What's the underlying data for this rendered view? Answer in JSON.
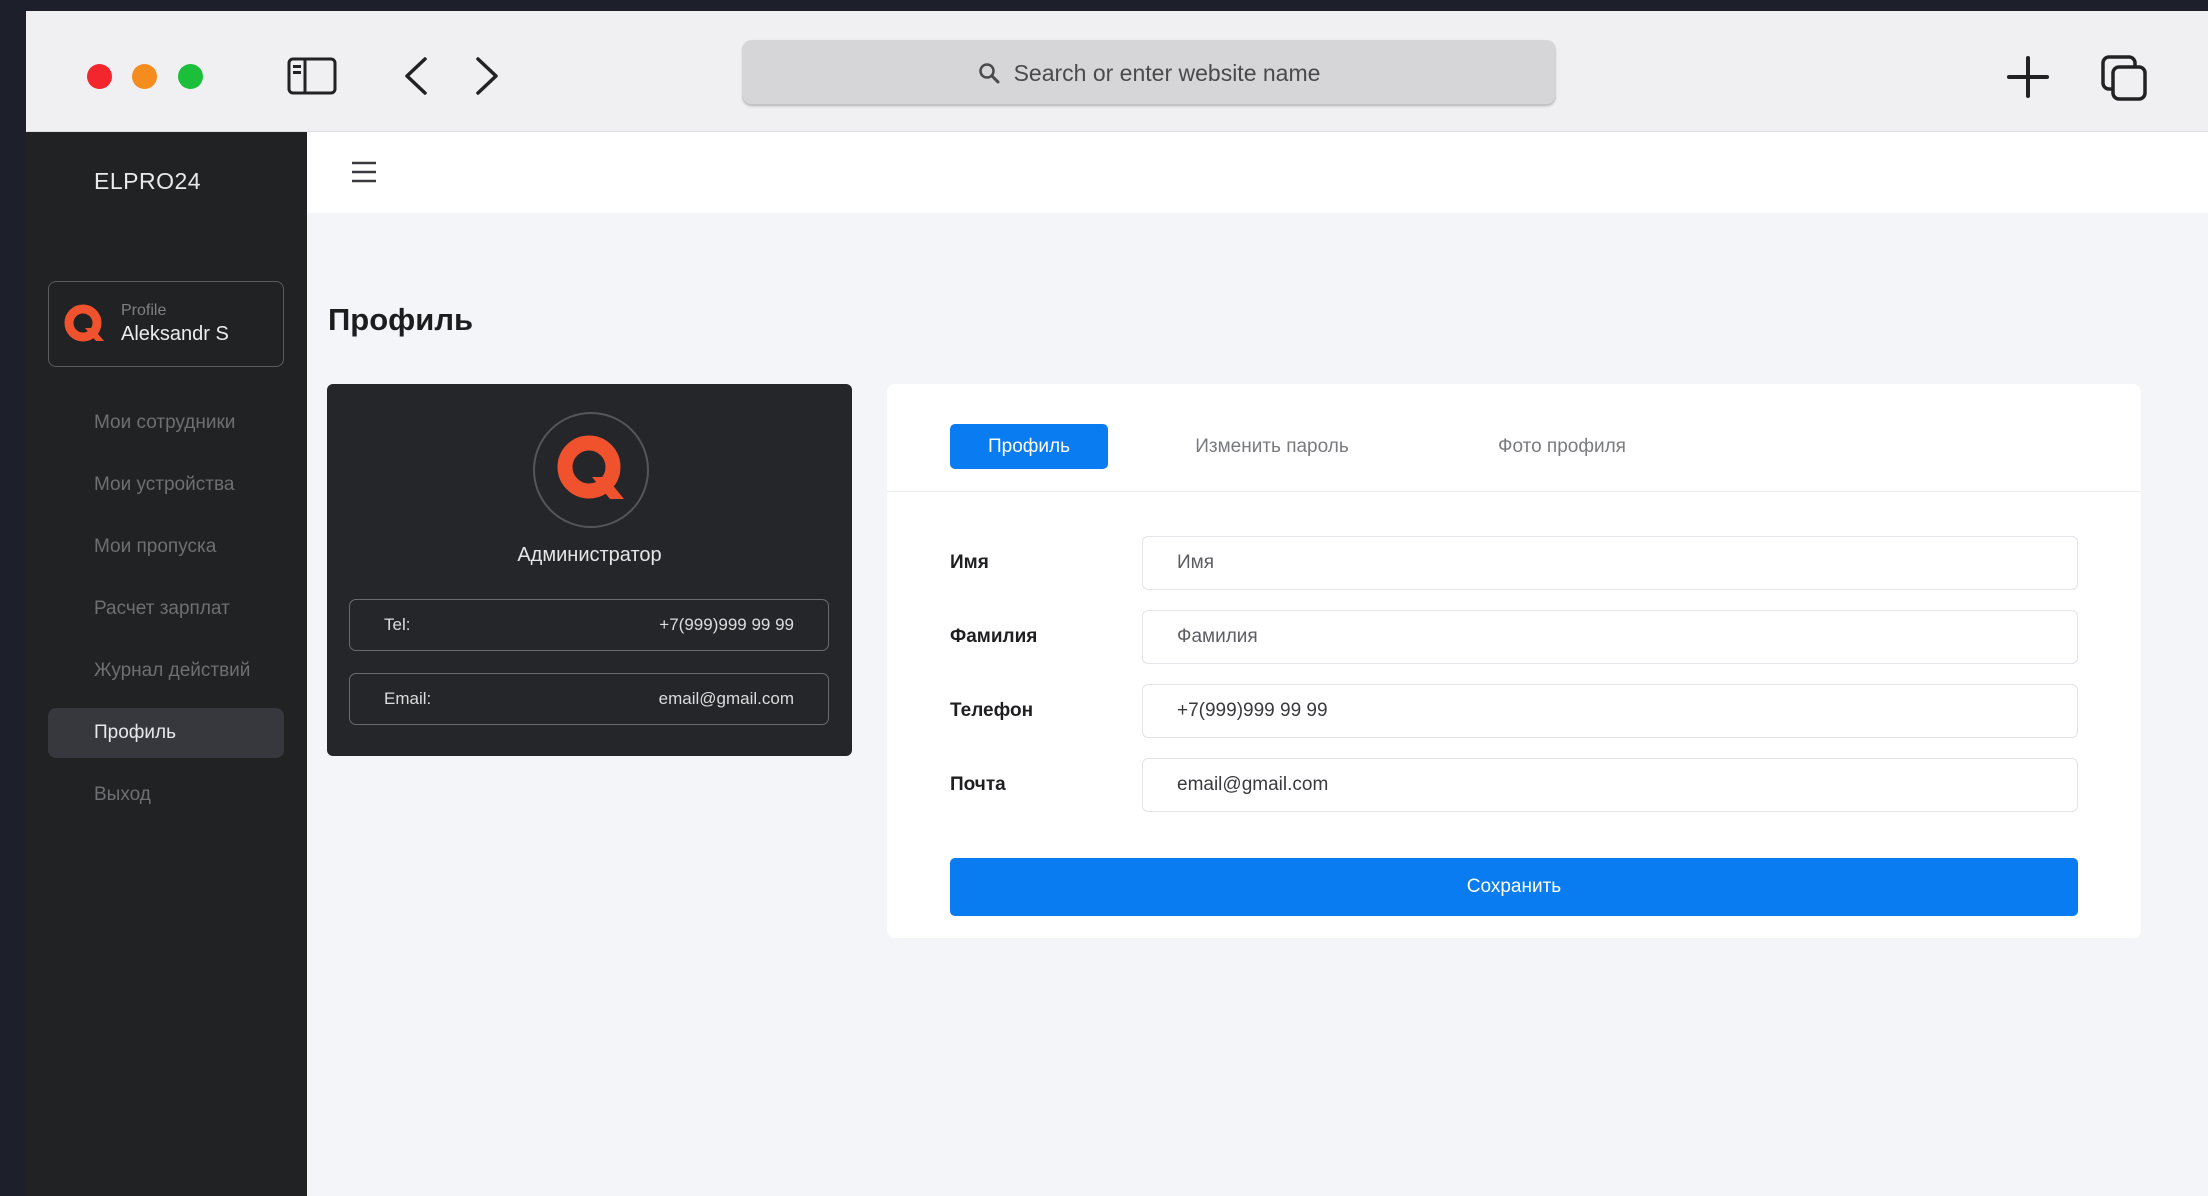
{
  "browser": {
    "address_placeholder": "Search or enter website name",
    "icons": [
      "sidebar-toggle-icon",
      "back-icon",
      "forward-icon",
      "search-icon",
      "new-tab-icon",
      "tabs-icon"
    ]
  },
  "sidebar": {
    "brand": "ELPRO24",
    "profile": {
      "caption": "Profile",
      "name": "Aleksandr S"
    },
    "items": [
      {
        "label": "Мои сотрудники",
        "active": false
      },
      {
        "label": "Мои устройства",
        "active": false
      },
      {
        "label": "Мои пропуска",
        "active": false
      },
      {
        "label": "Расчет зарплат",
        "active": false
      },
      {
        "label": "Журнал действий",
        "active": false
      },
      {
        "label": "Профиль",
        "active": true
      },
      {
        "label": "Выход",
        "active": false
      }
    ]
  },
  "page": {
    "title": "Профиль"
  },
  "admin_card": {
    "role": "Администратор",
    "tel_label": "Tel:",
    "tel_value": "+7(999)999 99 99",
    "email_label": "Email:",
    "email_value": "email@gmail.com"
  },
  "form": {
    "tabs": [
      {
        "label": "Профиль",
        "active": true
      },
      {
        "label": "Изменить пароль",
        "active": false
      },
      {
        "label": "Фото профиля",
        "active": false
      }
    ],
    "fields": [
      {
        "label": "Имя",
        "placeholder": "Имя",
        "value": ""
      },
      {
        "label": "Фамилия",
        "placeholder": "Фамилия",
        "value": ""
      },
      {
        "label": "Телефон",
        "placeholder": "",
        "value": "+7(999)999 99 99"
      },
      {
        "label": "Почта",
        "placeholder": "",
        "value": "email@gmail.com"
      }
    ],
    "save_label": "Сохранить"
  },
  "colors": {
    "accent": "#0a7cf1",
    "brand_logo": "#f0522e",
    "sidebar_bg": "#212224",
    "card_bg": "#252629"
  }
}
